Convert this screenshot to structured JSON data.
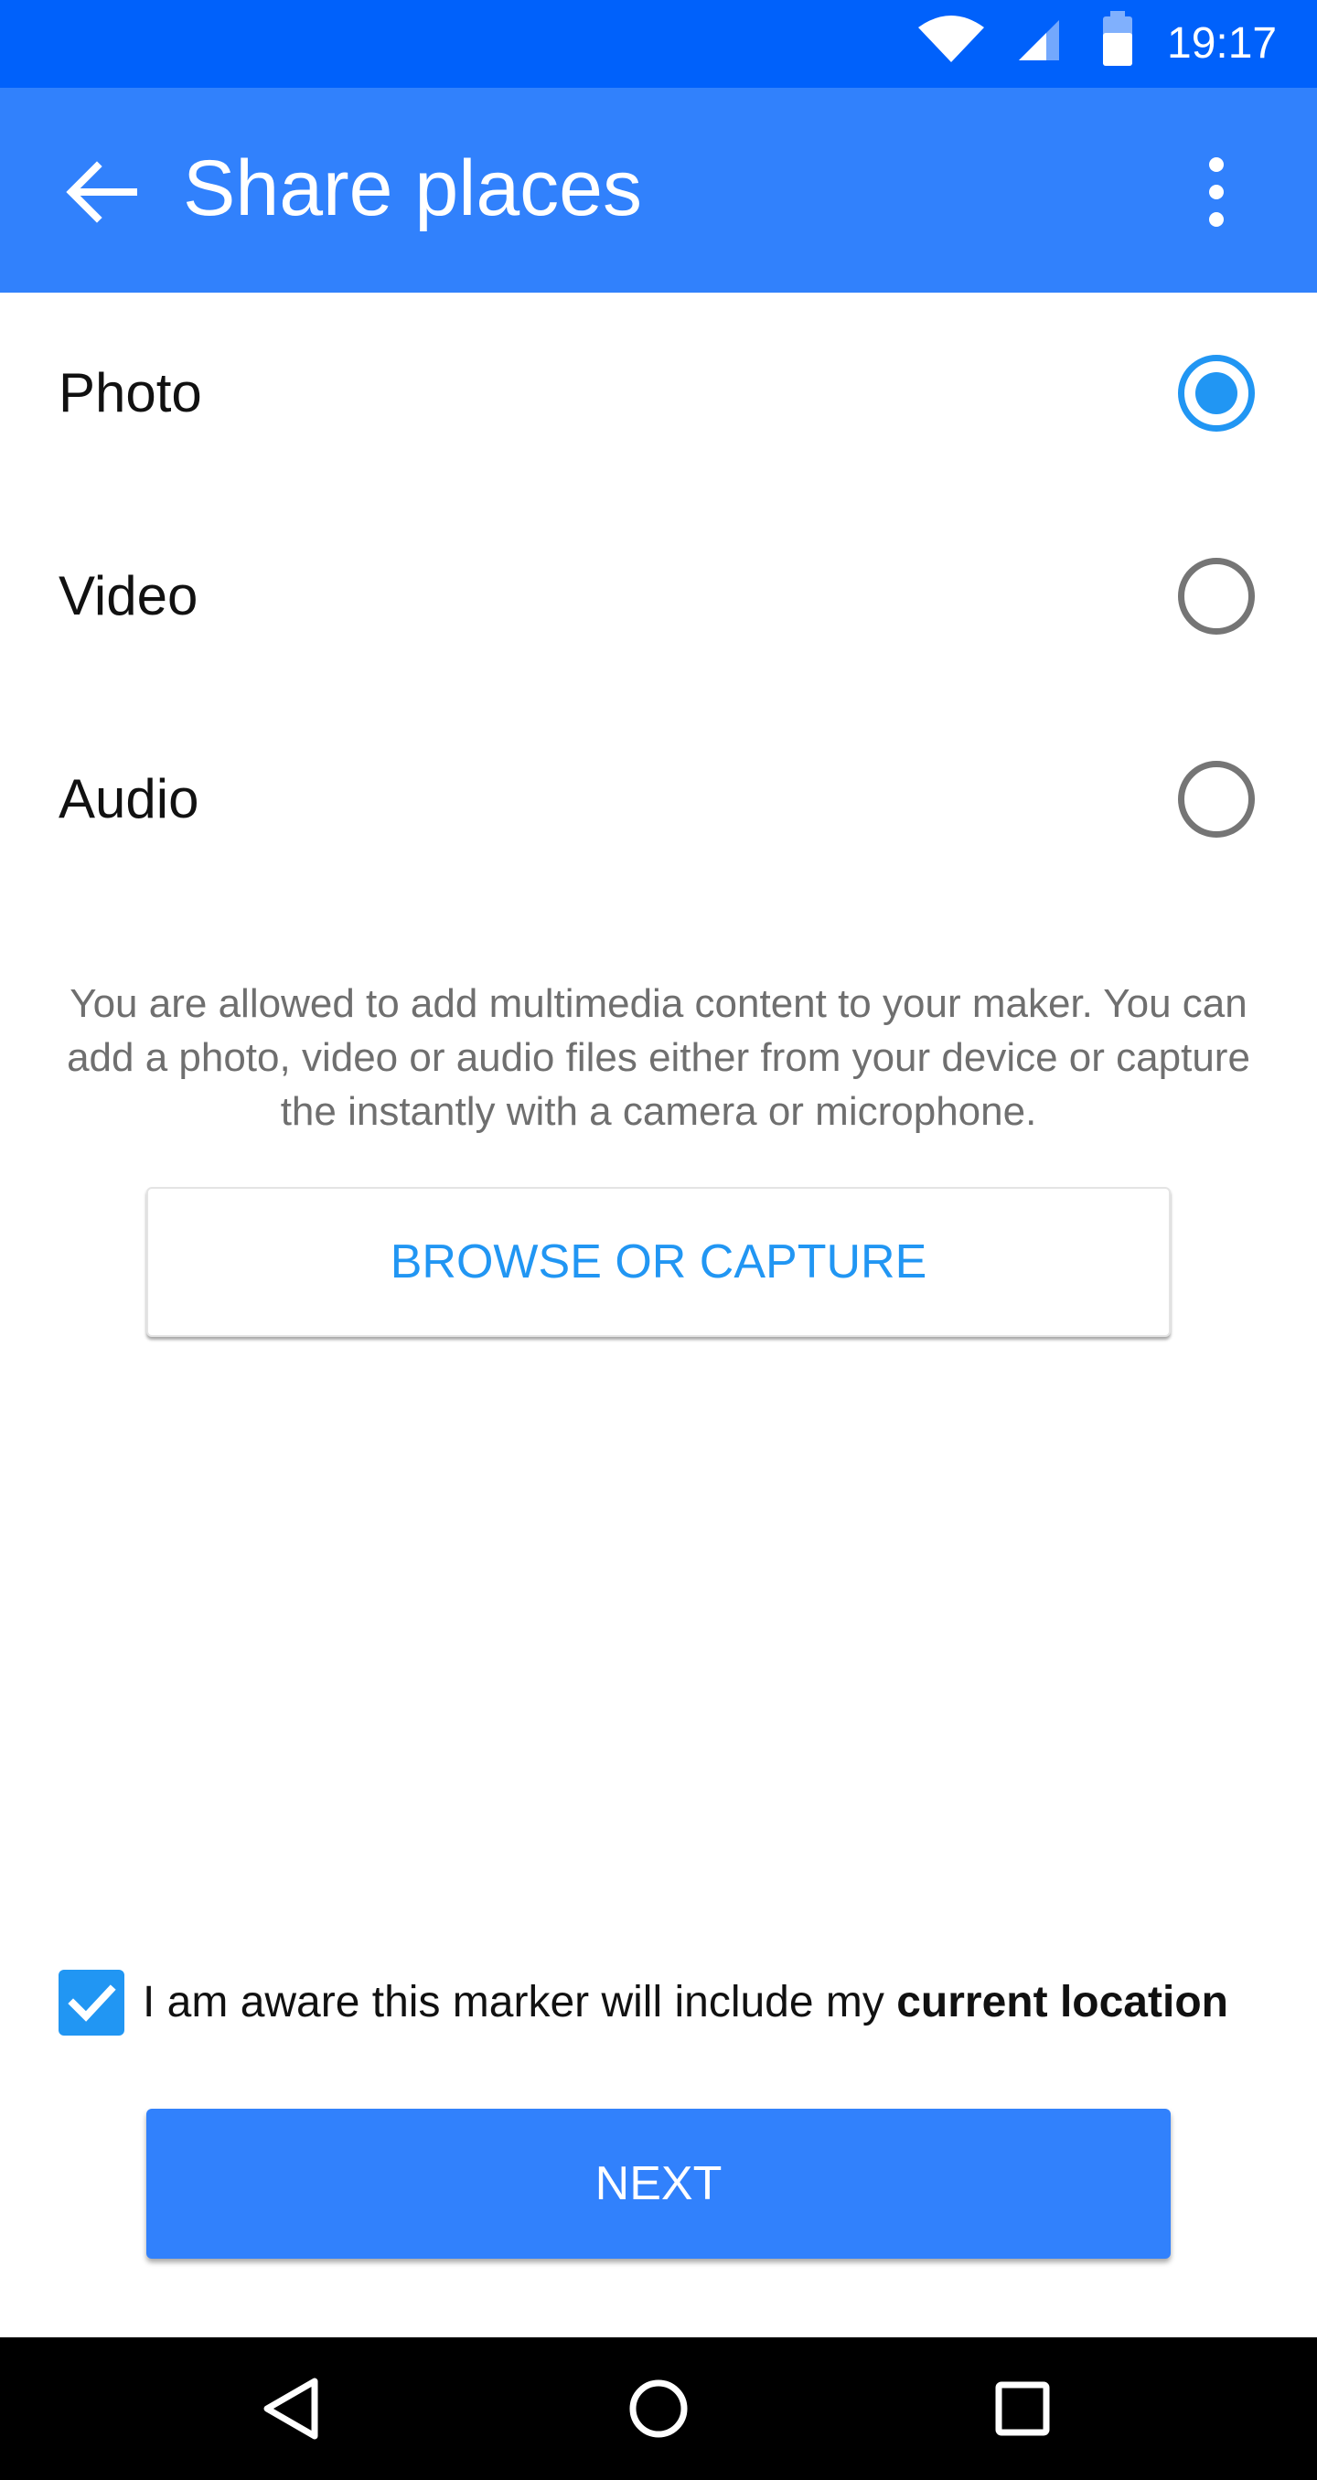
{
  "status_bar": {
    "time": "19:17",
    "wifi_icon": "wifi-icon",
    "signal_icon": "cell-signal-icon",
    "battery_icon": "battery-icon"
  },
  "app_bar": {
    "title": "Share places",
    "back_icon": "arrow-back-icon",
    "menu_icon": "more-vert-icon"
  },
  "media_options": [
    {
      "label": "Photo",
      "selected": true
    },
    {
      "label": "Video",
      "selected": false
    },
    {
      "label": "Audio",
      "selected": false
    }
  ],
  "description": "You are allowed to add multimedia content to your maker. You can add a photo, video or audio files either from your device or capture the instantly with a camera or microphone.",
  "browse_button": {
    "label": "BROWSE OR CAPTURE"
  },
  "awareness": {
    "checked": true,
    "text_prefix": "I am aware this marker will include my",
    "text_bold": "current location"
  },
  "next_button": {
    "label": "NEXT"
  },
  "nav_bar": {
    "back_icon": "nav-back-icon",
    "home_icon": "nav-home-icon",
    "recents_icon": "nav-recents-icon"
  },
  "colors": {
    "status_bar": "#0061fb",
    "app_bar": "#3181fc",
    "accent": "#2196f3",
    "next_button": "#3181fc"
  }
}
